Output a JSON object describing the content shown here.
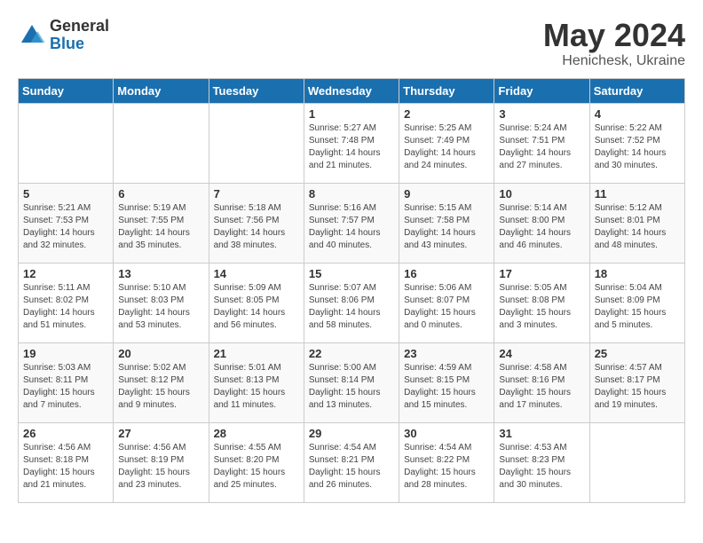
{
  "logo": {
    "general": "General",
    "blue": "Blue"
  },
  "header": {
    "month_year": "May 2024",
    "location": "Henichesk, Ukraine"
  },
  "weekdays": [
    "Sunday",
    "Monday",
    "Tuesday",
    "Wednesday",
    "Thursday",
    "Friday",
    "Saturday"
  ],
  "weeks": [
    [
      {
        "day": "",
        "info": ""
      },
      {
        "day": "",
        "info": ""
      },
      {
        "day": "",
        "info": ""
      },
      {
        "day": "1",
        "sunrise": "5:27 AM",
        "sunset": "7:48 PM",
        "daylight": "14 hours and 21 minutes."
      },
      {
        "day": "2",
        "sunrise": "5:25 AM",
        "sunset": "7:49 PM",
        "daylight": "14 hours and 24 minutes."
      },
      {
        "day": "3",
        "sunrise": "5:24 AM",
        "sunset": "7:51 PM",
        "daylight": "14 hours and 27 minutes."
      },
      {
        "day": "4",
        "sunrise": "5:22 AM",
        "sunset": "7:52 PM",
        "daylight": "14 hours and 30 minutes."
      }
    ],
    [
      {
        "day": "5",
        "sunrise": "5:21 AM",
        "sunset": "7:53 PM",
        "daylight": "14 hours and 32 minutes."
      },
      {
        "day": "6",
        "sunrise": "5:19 AM",
        "sunset": "7:55 PM",
        "daylight": "14 hours and 35 minutes."
      },
      {
        "day": "7",
        "sunrise": "5:18 AM",
        "sunset": "7:56 PM",
        "daylight": "14 hours and 38 minutes."
      },
      {
        "day": "8",
        "sunrise": "5:16 AM",
        "sunset": "7:57 PM",
        "daylight": "14 hours and 40 minutes."
      },
      {
        "day": "9",
        "sunrise": "5:15 AM",
        "sunset": "7:58 PM",
        "daylight": "14 hours and 43 minutes."
      },
      {
        "day": "10",
        "sunrise": "5:14 AM",
        "sunset": "8:00 PM",
        "daylight": "14 hours and 46 minutes."
      },
      {
        "day": "11",
        "sunrise": "5:12 AM",
        "sunset": "8:01 PM",
        "daylight": "14 hours and 48 minutes."
      }
    ],
    [
      {
        "day": "12",
        "sunrise": "5:11 AM",
        "sunset": "8:02 PM",
        "daylight": "14 hours and 51 minutes."
      },
      {
        "day": "13",
        "sunrise": "5:10 AM",
        "sunset": "8:03 PM",
        "daylight": "14 hours and 53 minutes."
      },
      {
        "day": "14",
        "sunrise": "5:09 AM",
        "sunset": "8:05 PM",
        "daylight": "14 hours and 56 minutes."
      },
      {
        "day": "15",
        "sunrise": "5:07 AM",
        "sunset": "8:06 PM",
        "daylight": "14 hours and 58 minutes."
      },
      {
        "day": "16",
        "sunrise": "5:06 AM",
        "sunset": "8:07 PM",
        "daylight": "15 hours and 0 minutes."
      },
      {
        "day": "17",
        "sunrise": "5:05 AM",
        "sunset": "8:08 PM",
        "daylight": "15 hours and 3 minutes."
      },
      {
        "day": "18",
        "sunrise": "5:04 AM",
        "sunset": "8:09 PM",
        "daylight": "15 hours and 5 minutes."
      }
    ],
    [
      {
        "day": "19",
        "sunrise": "5:03 AM",
        "sunset": "8:11 PM",
        "daylight": "15 hours and 7 minutes."
      },
      {
        "day": "20",
        "sunrise": "5:02 AM",
        "sunset": "8:12 PM",
        "daylight": "15 hours and 9 minutes."
      },
      {
        "day": "21",
        "sunrise": "5:01 AM",
        "sunset": "8:13 PM",
        "daylight": "15 hours and 11 minutes."
      },
      {
        "day": "22",
        "sunrise": "5:00 AM",
        "sunset": "8:14 PM",
        "daylight": "15 hours and 13 minutes."
      },
      {
        "day": "23",
        "sunrise": "4:59 AM",
        "sunset": "8:15 PM",
        "daylight": "15 hours and 15 minutes."
      },
      {
        "day": "24",
        "sunrise": "4:58 AM",
        "sunset": "8:16 PM",
        "daylight": "15 hours and 17 minutes."
      },
      {
        "day": "25",
        "sunrise": "4:57 AM",
        "sunset": "8:17 PM",
        "daylight": "15 hours and 19 minutes."
      }
    ],
    [
      {
        "day": "26",
        "sunrise": "4:56 AM",
        "sunset": "8:18 PM",
        "daylight": "15 hours and 21 minutes."
      },
      {
        "day": "27",
        "sunrise": "4:56 AM",
        "sunset": "8:19 PM",
        "daylight": "15 hours and 23 minutes."
      },
      {
        "day": "28",
        "sunrise": "4:55 AM",
        "sunset": "8:20 PM",
        "daylight": "15 hours and 25 minutes."
      },
      {
        "day": "29",
        "sunrise": "4:54 AM",
        "sunset": "8:21 PM",
        "daylight": "15 hours and 26 minutes."
      },
      {
        "day": "30",
        "sunrise": "4:54 AM",
        "sunset": "8:22 PM",
        "daylight": "15 hours and 28 minutes."
      },
      {
        "day": "31",
        "sunrise": "4:53 AM",
        "sunset": "8:23 PM",
        "daylight": "15 hours and 30 minutes."
      },
      {
        "day": "",
        "info": ""
      }
    ]
  ]
}
